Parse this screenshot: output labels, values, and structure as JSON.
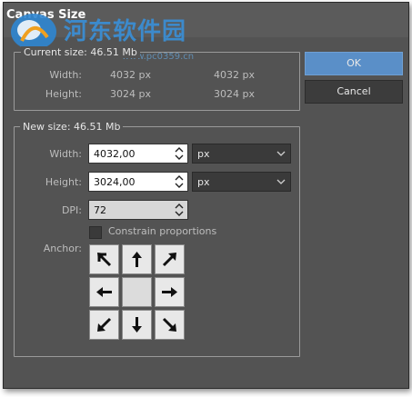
{
  "window": {
    "title": "Canvas Size"
  },
  "watermark": {
    "text": "河东软件园",
    "url": "www.pc0359.cn"
  },
  "current": {
    "legend": "Current size: 46.51 Mb",
    "width_label": "Width:",
    "height_label": "Height:",
    "width_px": "4032 px",
    "height_px": "3024 px",
    "width_px2": "4032 px",
    "height_px2": "3024 px"
  },
  "buttons": {
    "ok": "OK",
    "cancel": "Cancel"
  },
  "newsize": {
    "legend": "New size: 46.51 Mb",
    "width_label": "Width:",
    "height_label": "Height:",
    "dpi_label": "DPI:",
    "width_value": "4032,00",
    "height_value": "3024,00",
    "dpi_value": "72",
    "width_unit": "px",
    "height_unit": "px",
    "constrain_label": "Constrain proportions",
    "constrain_checked": false,
    "anchor_label": "Anchor:"
  },
  "anchor": {
    "cells": [
      "arrow-nw-icon",
      "arrow-n-icon",
      "arrow-ne-icon",
      "arrow-w-icon",
      "center",
      "arrow-e-icon",
      "arrow-sw-icon",
      "arrow-s-icon",
      "arrow-se-icon"
    ]
  },
  "colors": {
    "panel_bg": "#535353",
    "ok_button": "#5a8fc8",
    "cancel_button": "#3c3c3c"
  }
}
